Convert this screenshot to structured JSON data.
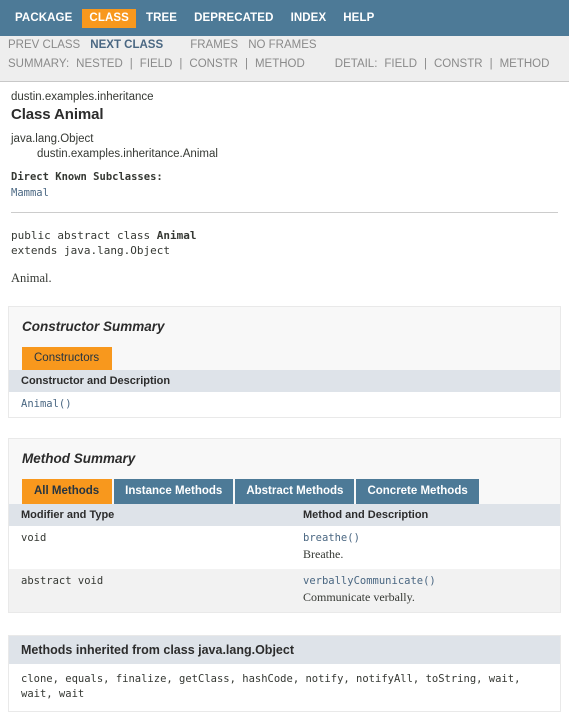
{
  "colors": {
    "nav_bg": "#4D7A97",
    "accent_orange": "#F8981D",
    "link": "#4A6782",
    "table_header_bg": "#dee3e9",
    "section_bg": "#f8f8f8"
  },
  "top_nav": {
    "items": [
      {
        "label": "PACKAGE",
        "active": false
      },
      {
        "label": "CLASS",
        "active": true
      },
      {
        "label": "TREE",
        "active": false
      },
      {
        "label": "DEPRECATED",
        "active": false
      },
      {
        "label": "INDEX",
        "active": false
      },
      {
        "label": "HELP",
        "active": false
      }
    ]
  },
  "sub_nav": {
    "prev_class": "PREV CLASS",
    "next_class": "NEXT CLASS",
    "frames": "FRAMES",
    "no_frames": "NO FRAMES",
    "summary_label": "SUMMARY:",
    "summary_nested": "NESTED",
    "summary_field": "FIELD",
    "summary_constr": "CONSTR",
    "summary_method": "METHOD",
    "detail_label": "DETAIL:",
    "detail_field": "FIELD",
    "detail_constr": "CONSTR",
    "detail_method": "METHOD",
    "sep": "|"
  },
  "header": {
    "package": "dustin.examples.inheritance",
    "title": "Class Animal"
  },
  "inheritance": {
    "level1": "java.lang.Object",
    "level2": "dustin.examples.inheritance.Animal"
  },
  "subclasses": {
    "label": "Direct Known Subclasses:",
    "items": [
      "Mammal"
    ]
  },
  "declaration": {
    "line1_prefix": "public abstract class ",
    "line1_type": "Animal",
    "line2": "extends java.lang.Object",
    "description": "Animal."
  },
  "constructor_summary": {
    "title": "Constructor Summary",
    "caption": "Constructors",
    "column_header": "Constructor and Description",
    "rows": [
      {
        "signature": "Animal()",
        "description": ""
      }
    ]
  },
  "method_summary": {
    "title": "Method Summary",
    "tabs": [
      {
        "label": "All Methods",
        "active": true
      },
      {
        "label": "Instance Methods",
        "active": false
      },
      {
        "label": "Abstract Methods",
        "active": false
      },
      {
        "label": "Concrete Methods",
        "active": false
      }
    ],
    "columns": [
      "Modifier and Type",
      "Method and Description"
    ],
    "rows": [
      {
        "modifier": "void",
        "method": "breathe()",
        "description": "Breathe."
      },
      {
        "modifier": "abstract void",
        "method": "verballyCommunicate()",
        "description": "Communicate verbally."
      }
    ]
  },
  "inherited": {
    "header": "Methods inherited from class java.lang.Object",
    "methods": "clone, equals, finalize, getClass, hashCode, notify, notifyAll, toString, wait, wait, wait"
  }
}
